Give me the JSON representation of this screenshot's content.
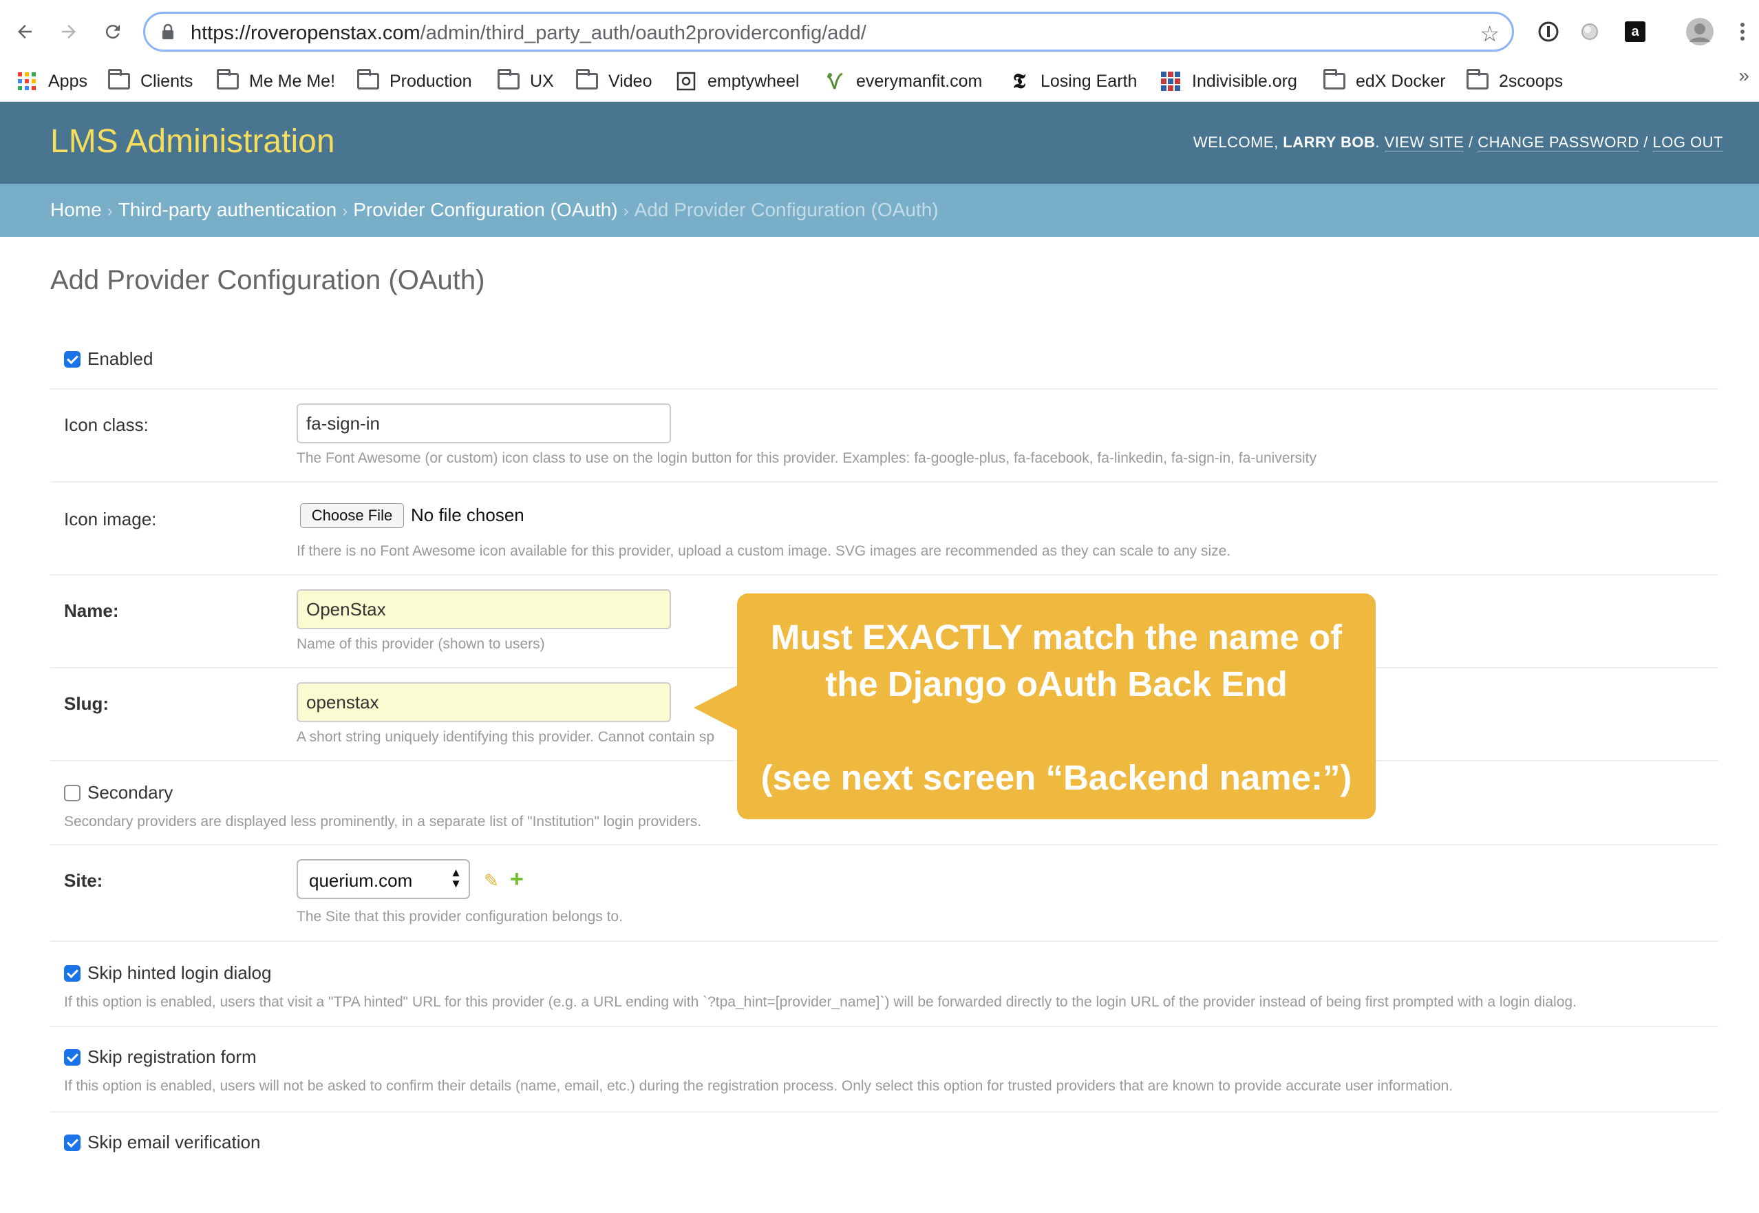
{
  "browser": {
    "url_host": "https://roveropenstax.com",
    "url_path": "/admin/third_party_auth/oauth2providerconfig/add/",
    "bookmarks": [
      {
        "label": "Apps",
        "icon": "apps-grid-icon"
      },
      {
        "label": "Clients",
        "icon": "folder-icon"
      },
      {
        "label": "Me Me Me!",
        "icon": "folder-icon"
      },
      {
        "label": "Production",
        "icon": "folder-icon"
      },
      {
        "label": "UX",
        "icon": "folder-icon"
      },
      {
        "label": "Video",
        "icon": "folder-icon"
      },
      {
        "label": "emptywheel",
        "icon": "emptywheel-icon"
      },
      {
        "label": "everymanfit.com",
        "icon": "everymanfit-icon"
      },
      {
        "label": "Losing Earth",
        "icon": "nyt-icon"
      },
      {
        "label": "Indivisible.org",
        "icon": "indivisible-icon"
      },
      {
        "label": "edX Docker",
        "icon": "folder-icon"
      },
      {
        "label": "2scoops",
        "icon": "folder-icon"
      }
    ],
    "more_glyph": "»"
  },
  "header": {
    "branding": "LMS Administration",
    "welcome": "WELCOME, ",
    "user_name": "LARRY BOB",
    "dot": ". ",
    "view_site": "VIEW SITE",
    "change_password": "CHANGE PASSWORD",
    "log_out": "LOG OUT",
    "slash": " / "
  },
  "breadcrumbs": {
    "home": "Home",
    "tpa": "Third-party authentication",
    "config": "Provider Configuration (OAuth)",
    "current": "Add Provider Configuration (OAuth)",
    "sep": "›"
  },
  "page_title": "Add Provider Configuration (OAuth)",
  "form": {
    "enabled": {
      "label": "Enabled",
      "checked": true
    },
    "icon_class": {
      "label": "Icon class:",
      "value": "fa-sign-in",
      "help": "The Font Awesome (or custom) icon class to use on the login button for this provider. Examples: fa-google-plus, fa-facebook, fa-linkedin, fa-sign-in, fa-university"
    },
    "icon_image": {
      "label": "Icon image:",
      "button": "Choose File",
      "status": "No file chosen",
      "help": "If there is no Font Awesome icon available for this provider, upload a custom image. SVG images are recommended as they can scale to any size."
    },
    "name": {
      "label": "Name:",
      "value": "OpenStax",
      "help": "Name of this provider (shown to users)"
    },
    "slug": {
      "label": "Slug:",
      "value": "openstax",
      "help": "A short string uniquely identifying this provider. Cannot contain sp"
    },
    "secondary": {
      "label": "Secondary",
      "checked": false,
      "help": "Secondary providers are displayed less prominently, in a separate list of \"Institution\" login providers."
    },
    "site": {
      "label": "Site:",
      "value": "querium.com",
      "help": "The Site that this provider configuration belongs to."
    },
    "skip_hinted": {
      "label": "Skip hinted login dialog",
      "checked": true,
      "help": "If this option is enabled, users that visit a \"TPA hinted\" URL for this provider (e.g. a URL ending with `?tpa_hint=[provider_name]`) will be forwarded directly to the login URL of the provider instead of being first prompted with a login dialog."
    },
    "skip_registration": {
      "label": "Skip registration form",
      "checked": true,
      "help": "If this option is enabled, users will not be asked to confirm their details (name, email, etc.) during the registration process. Only select this option for trusted providers that are known to provide accurate user information."
    },
    "skip_email": {
      "label": "Skip email verification",
      "checked": true
    }
  },
  "callout": {
    "line1": "Must EXACTLY match the name of",
    "line2": "the Django oAuth Back End",
    "line3": "(see next screen “Backend name:”)"
  },
  "colors": {
    "header_bg": "#4a7590",
    "breadcrumb_bg": "#79aec8",
    "branding_yellow": "#f5dd5d",
    "callout_bg": "#eeb93e",
    "checkbox_blue": "#1a73e8"
  }
}
